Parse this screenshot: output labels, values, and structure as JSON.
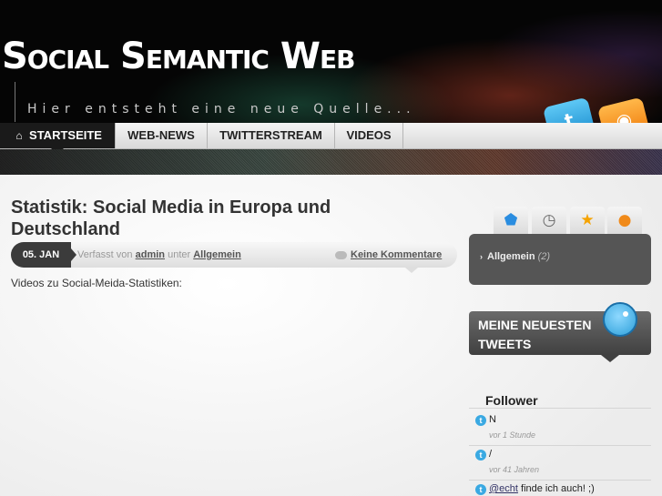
{
  "header": {
    "site_title": "Social Semantic Web",
    "tagline": "Hier entsteht eine neue Quelle...",
    "social_icons": [
      "twitter-icon",
      "rss-icon"
    ]
  },
  "nav": {
    "items": [
      {
        "label": "Startseite",
        "active": true
      },
      {
        "label": "Web-News"
      },
      {
        "label": "Twitterstream"
      },
      {
        "label": "Videos"
      }
    ]
  },
  "post": {
    "title": "Statistik: Social Media in Europa und Deutschland",
    "date": "05. JAN",
    "meta_prefix": "Verfasst von",
    "author": "admin",
    "meta_middle": "unter",
    "category": "Allgemein",
    "comments": "Keine Kommentare",
    "excerpt": "Videos zu Social-Meida-Statistiken:"
  },
  "sidebar": {
    "tabs": [
      "tag-icon",
      "clock-icon",
      "star-icon",
      "speech-bubble-icon"
    ],
    "category": {
      "label": "Allgemein",
      "count": "(2)"
    },
    "tweets_heading": "Meine neuesten Tweets",
    "follower_heading": "Follower",
    "tweets": [
      {
        "text": "N",
        "time": "vor 1 Stunde"
      },
      {
        "text": "/",
        "time": "vor 41 Jahren"
      },
      {
        "mention": "@echt",
        "text": " finde ich auch! ;)"
      }
    ]
  },
  "colors": {
    "header_bg": "#050505",
    "nav_active_bg": "#1a1a1a",
    "sidebar_box": "#555555",
    "twitter_blue": "#3aa9e2",
    "rss_orange": "#f07c0c"
  }
}
